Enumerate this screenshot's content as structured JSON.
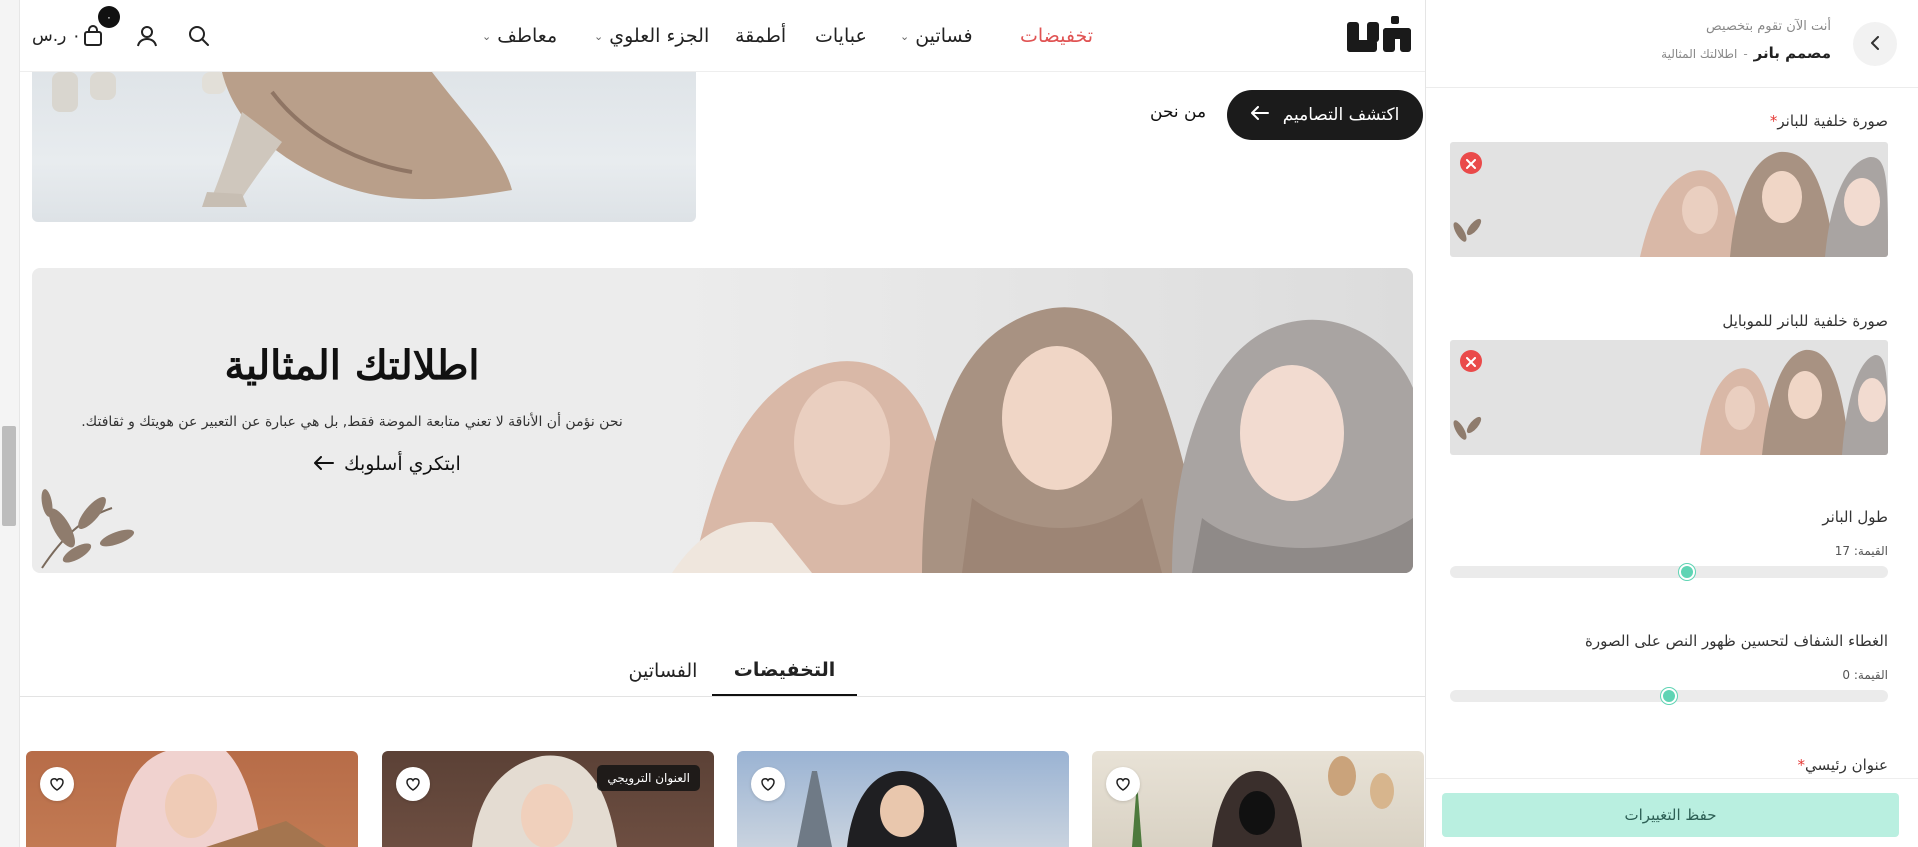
{
  "header": {
    "logo_text": "لنوا",
    "nav": [
      {
        "label": "تخفيضات",
        "has_dropdown": false
      },
      {
        "label": "فساتين",
        "has_dropdown": true
      },
      {
        "label": "عبايات",
        "has_dropdown": false
      },
      {
        "label": "أطمقة",
        "has_dropdown": false
      },
      {
        "label": "الجزء العلوي",
        "has_dropdown": true
      },
      {
        "label": "معاطف",
        "has_dropdown": true
      }
    ],
    "cart_count": "٠",
    "cart_total": "٠ ر.س"
  },
  "top_section": {
    "explore_button": "اكتشف التصاميم",
    "about_link": "من نحن"
  },
  "hero": {
    "title": "اطلالتك المثالية",
    "subtitle": "نحن نؤمن أن الأناقة لا تعني متابعة الموضة فقط, بل هي عبارة عن التعبير عن هويتك و ثقافتك.",
    "cta": "ابتكري أسلوبك"
  },
  "tabs": [
    {
      "label": "التخفيضات",
      "active": true
    },
    {
      "label": "الفساتين",
      "active": false
    }
  ],
  "products": [
    {
      "promo_tag": ""
    },
    {
      "promo_tag": "العنوان الترويجي"
    },
    {
      "promo_tag": ""
    },
    {
      "promo_tag": ""
    }
  ],
  "panel": {
    "customizing_note": "أنت الآن تقوم بتخصيص",
    "crumb_main": "مصمم بانر",
    "crumb_separator": "-",
    "crumb_sub": "اطلالتك المثالية",
    "fields": {
      "background_image": {
        "label": "صورة خلفية للبانر",
        "required": true
      },
      "mobile_background_image": {
        "label": "صورة خلفية للبانر للموبايل",
        "required": false
      },
      "banner_height": {
        "label": "طول البانر",
        "value_prefix": "القيمة:",
        "value": 17,
        "fraction": 0.54
      },
      "overlay": {
        "label": "الغطاء الشفاف لتحسين ظهور النص على الصورة",
        "value_prefix": "القيمة:",
        "value": 0,
        "fraction": 0.5
      },
      "main_title": {
        "label": "عنوان رئيسي",
        "required": true
      }
    },
    "save_button": "حفظ التغييرات"
  },
  "colors": {
    "accent_sale": "#e05353",
    "slider_thumb": "#5fd4b4",
    "save_button_bg": "#b9efe0",
    "remove_button": "#ea4a4a",
    "primary_dark": "#1b1b1b"
  },
  "icons": [
    "search-icon",
    "user-icon",
    "cart-icon",
    "chevron-down-icon",
    "arrow-left-icon",
    "heart-icon",
    "close-icon",
    "chevron-left-icon"
  ]
}
